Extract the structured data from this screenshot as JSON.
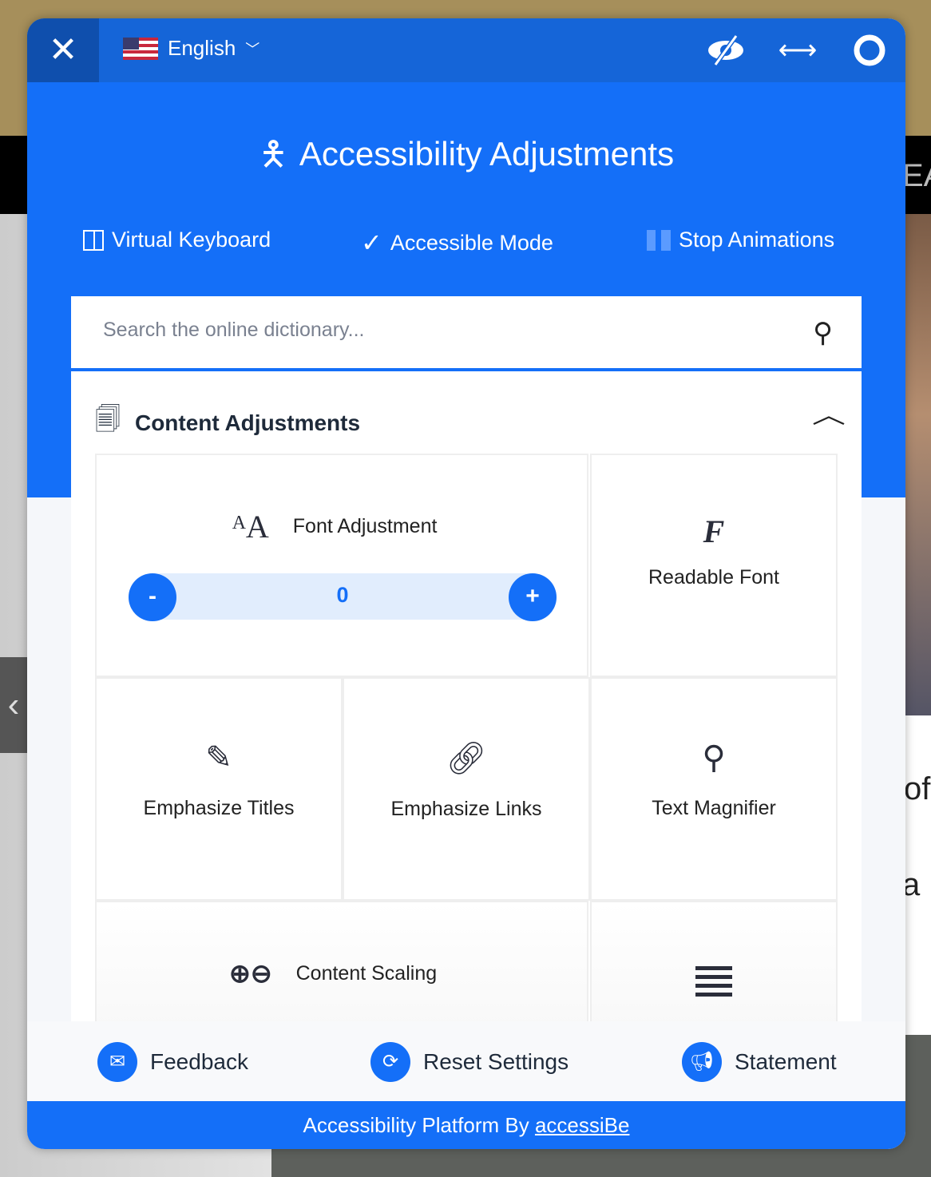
{
  "background": {
    "heading_fragment": "EA",
    "text_fragment_1": "of",
    "text_fragment_2": "a"
  },
  "header": {
    "language": "English",
    "icons": [
      "eye-slash-icon",
      "arrows-horizontal-icon",
      "lifebuoy-icon"
    ]
  },
  "title": "Accessibility Adjustments",
  "modes": [
    {
      "label": "Virtual Keyboard",
      "icon": "keyboard-icon"
    },
    {
      "label": "Accessible Mode",
      "icon": "checkmark-icon"
    },
    {
      "label": "Stop Animations",
      "icon": "pause-icon"
    }
  ],
  "search": {
    "placeholder": "Search the online dictionary..."
  },
  "section": {
    "title": "Content Adjustments",
    "expanded": true
  },
  "tiles": {
    "font_adjustment": {
      "label": "Font Adjustment",
      "value": "0",
      "minus": "-",
      "plus": "+"
    },
    "readable_font": "Readable Font",
    "emphasize_titles": "Emphasize Titles",
    "emphasize_links": "Emphasize Links",
    "text_magnifier": "Text Magnifier",
    "content_scaling": "Content Scaling"
  },
  "footer": {
    "feedback": "Feedback",
    "reset": "Reset Settings",
    "statement": "Statement"
  },
  "bar": {
    "text": "Accessibility Platform By",
    "link": "accessiBe"
  },
  "colors": {
    "primary": "#146ff8",
    "header": "#1565d8",
    "close": "#0f4fad"
  }
}
